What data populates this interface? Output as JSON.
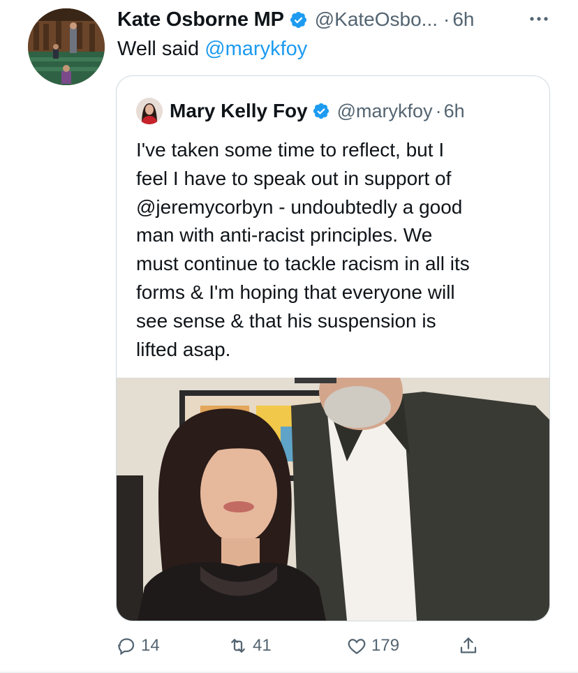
{
  "author": {
    "display_name": "Kate Osborne MP",
    "handle": "@KateOsbo...",
    "separator": "·",
    "time": "6h",
    "verified_icon": "verified-badge-icon",
    "more_icon": "more-options-icon"
  },
  "tweet": {
    "text_prefix": "Well said ",
    "mention": "@marykfoy"
  },
  "quoted": {
    "display_name": "Mary Kelly Foy",
    "handle": "@marykfoy",
    "separator": "·",
    "time": "6h",
    "lines": [
      "I've taken some time to reflect, but I",
      "feel I have to speak out in support of",
      "@jeremycorbyn - undoubtedly a good",
      "man with anti-racist principles. We",
      "must continue to tackle racism in all its",
      "forms & I'm hoping that everyone will",
      "see sense & that his suspension is",
      "lifted asap."
    ]
  },
  "actions": {
    "reply": {
      "icon": "reply-icon",
      "count": "14"
    },
    "retweet": {
      "icon": "retweet-icon",
      "count": "41"
    },
    "like": {
      "icon": "like-icon",
      "count": "179"
    },
    "share": {
      "icon": "share-icon"
    }
  },
  "colors": {
    "accent": "#1d9bf0",
    "text": "#0f1419",
    "secondary": "#536471",
    "border": "#cfd9de"
  }
}
